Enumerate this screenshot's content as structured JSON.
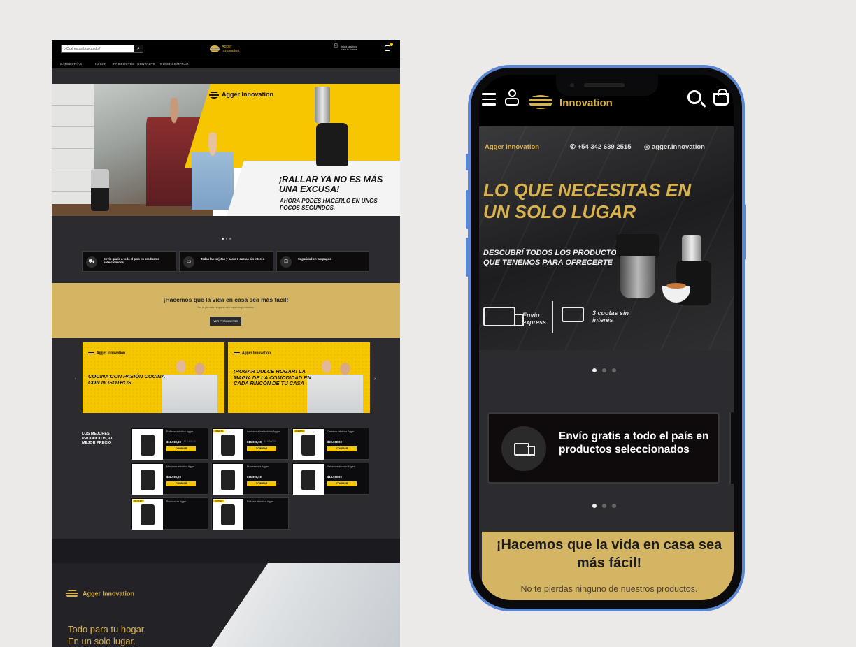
{
  "desktop": {
    "search_placeholder": "¿Qué estás buscando?",
    "logo_text": "Agger Innovation",
    "account_line1": "Iniciá sesión o",
    "account_line2": "creá tu cuenta",
    "nav": [
      "CATEGORÍAS",
      "INICIO",
      "PRODUCTOS",
      "CONTACTO",
      "CÓMO COMPRAR"
    ],
    "hero": {
      "brand": "Agger Innovation",
      "headline": "¡RALLAR YA NO ES MÁS UNA EXCUSA!",
      "subheadline": "AHORA PODES HACERLO EN UNOS POCOS SEGUNDOS."
    },
    "features": [
      "Envío gratis a todo el país en productos seleccionados",
      "Todas las tarjetas y hasta 3 cuotas sin interés",
      "Seguridad en tus pagos"
    ],
    "band": {
      "title": "¡Hacemos que la vida en casa sea más fácil!",
      "subtitle": "No te pierdas ninguno de nuestros productos.",
      "button": "VER PRODUCTOS"
    },
    "promos": [
      {
        "brand": "Agger Innovation",
        "text": "COCINA CON PASIÓN COCINA CON NOSOTROS"
      },
      {
        "brand": "Agger Innovation",
        "text": "¡HOGAR DULCE HOGAR! LA MAGIA DE LA COMODIDAD EN CADA RINCÓN DE TU CASA"
      }
    ],
    "best_title": "LOS MEJORES PRODUCTOS, AL MEJOR PRECIO",
    "products": [
      {
        "name": "Rallador eléctrico Agger",
        "price": "$10.900,00",
        "old": "$12.900,00",
        "button": "COMPRAR",
        "tag": ""
      },
      {
        "name": "Aspiradora inalámbrica Agger",
        "price": "$16.900,00",
        "old": "$19.900,00",
        "button": "COMPRAR",
        "tag": "OFERTA"
      },
      {
        "name": "Cafetera eléctrica Agger",
        "price": "$22.900,00",
        "old": "",
        "button": "COMPRAR",
        "tag": "OFERTA"
      },
      {
        "name": "Minipimer eléctrica Agger",
        "price": "$32.900,00",
        "old": "",
        "button": "COMPRAR",
        "tag": ""
      },
      {
        "name": "Procesadora Agger",
        "price": "$65.900,00",
        "old": "",
        "button": "COMPRAR",
        "tag": ""
      },
      {
        "name": "Selladora al vacío Agger",
        "price": "$13.900,00",
        "old": "",
        "button": "COMPRAR",
        "tag": ""
      },
      {
        "name": "Pochoclera Agger",
        "price": "",
        "old": "",
        "button": "",
        "tag": "OUTLET"
      },
      {
        "name": "Rallador eléctrico Agger",
        "price": "",
        "old": "",
        "button": "",
        "tag": "OUTLET"
      }
    ],
    "footer": {
      "logo": "Agger Innovation",
      "tagline_1": "Todo para tu hogar.",
      "tagline_2": "En un solo lugar."
    }
  },
  "phone": {
    "logo_text": "Innovation",
    "hero": {
      "brand": "Agger Innovation",
      "whatsapp": "+54 342 639 2515",
      "instagram": "agger.innovation",
      "headline": "LO QUE NECESITAS EN UN SOLO LUGAR",
      "subheadline": "DESCUBRÍ TODOS LOS PRODUCTOS QUE TENEMOS PARA OFRECERTE",
      "shipping": "Envío express",
      "installments": "3 cuotas sin interés"
    },
    "feature": "Envío gratis a todo el país en productos seleccionados",
    "band": {
      "title": "¡Hacemos que la vida en casa sea más fácil!",
      "subtitle": "No te pierdas ninguno de nuestros productos."
    }
  }
}
